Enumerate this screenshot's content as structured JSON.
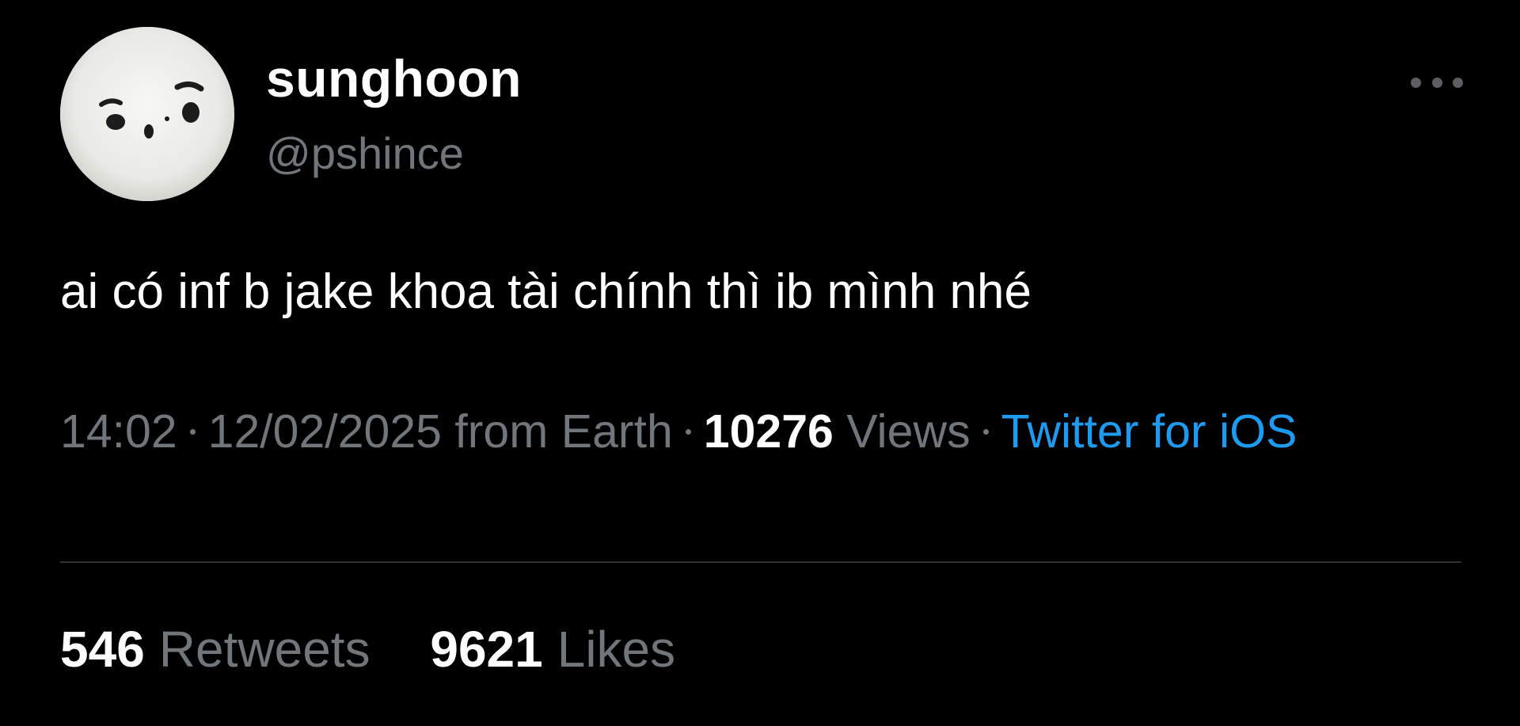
{
  "user": {
    "display_name": "sunghoon",
    "handle": "@pshince"
  },
  "tweet": {
    "text": "ai có inf b jake khoa tài chính thì ib mình nhé"
  },
  "meta": {
    "time": "14:02",
    "date": "12/02/2025",
    "location": "from Earth",
    "views_count": "10276",
    "views_label": "Views",
    "source": "Twitter for iOS"
  },
  "stats": {
    "retweets_count": "546",
    "retweets_label": "Retweets",
    "likes_count": "9621",
    "likes_label": "Likes"
  },
  "colors": {
    "background": "#000000",
    "text_primary": "#ffffff",
    "text_secondary": "#71767b",
    "accent": "#1d9bf0",
    "divider": "#2f3336"
  },
  "icons": {
    "avatar": "avatar-image",
    "more": "more-horizontal-icon"
  }
}
